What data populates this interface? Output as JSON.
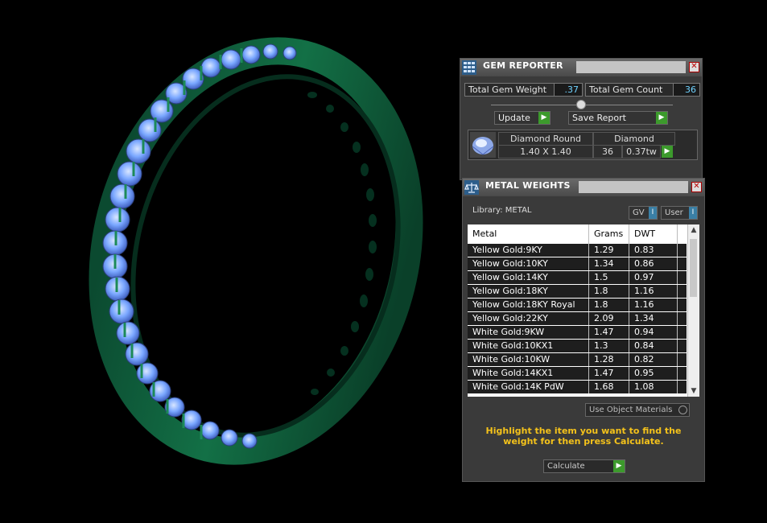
{
  "gem_reporter": {
    "title": "GEM REPORTER",
    "total_gem_weight_label": "Total Gem Weight",
    "total_gem_weight_value": ".37",
    "total_gem_count_label": "Total Gem Count",
    "total_gem_count_value": "36",
    "update_label": "Update",
    "save_report_label": "Save Report",
    "gem": {
      "shape": "Diamond Round",
      "material": "Diamond",
      "size": "1.40 X 1.40",
      "count": "36",
      "weight": "0.37tw"
    }
  },
  "metal_weights": {
    "title": "METAL WEIGHTS",
    "library_label": "Library: METAL",
    "gv_label": "GV",
    "user_label": "User",
    "columns": [
      "Metal",
      "Grams",
      "DWT"
    ],
    "rows": [
      {
        "metal": "Yellow Gold:9KY",
        "grams": "1.29",
        "dwt": "0.83"
      },
      {
        "metal": "Yellow Gold:10KY",
        "grams": "1.34",
        "dwt": "0.86"
      },
      {
        "metal": "Yellow Gold:14KY",
        "grams": "1.5",
        "dwt": "0.97"
      },
      {
        "metal": "Yellow Gold:18KY",
        "grams": "1.8",
        "dwt": "1.16"
      },
      {
        "metal": "Yellow Gold:18KY Royal",
        "grams": "1.8",
        "dwt": "1.16"
      },
      {
        "metal": "Yellow Gold:22KY",
        "grams": "2.09",
        "dwt": "1.34"
      },
      {
        "metal": "White Gold:9KW",
        "grams": "1.47",
        "dwt": "0.94"
      },
      {
        "metal": "White Gold:10KX1",
        "grams": "1.3",
        "dwt": "0.84"
      },
      {
        "metal": "White Gold:10KW",
        "grams": "1.28",
        "dwt": "0.82"
      },
      {
        "metal": "White Gold:14KX1",
        "grams": "1.47",
        "dwt": "0.95"
      },
      {
        "metal": "White Gold:14K PdW",
        "grams": "1.68",
        "dwt": "1.08"
      }
    ],
    "use_object_materials_label": "Use Object Materials",
    "hint": "Highlight the item you want to find the weight for then press Calculate.",
    "calculate_label": "Calculate"
  },
  "colors": {
    "ring": "#0f5a3a",
    "gem": "#7aa7ff",
    "accent_green": "#3c9a2c",
    "hint": "#f4c21b"
  }
}
